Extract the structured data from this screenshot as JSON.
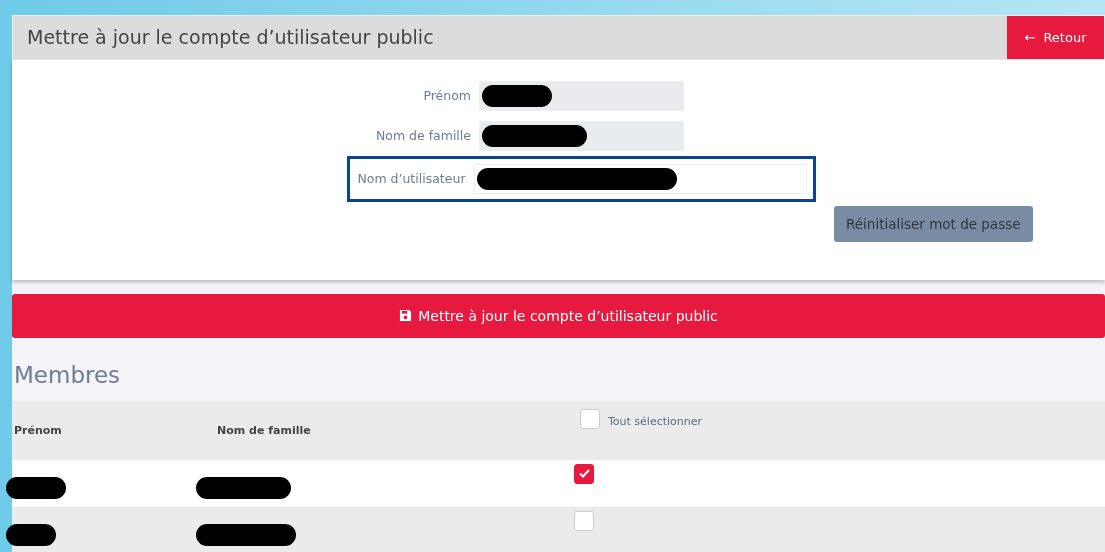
{
  "header": {
    "title": "Mettre à jour le compte d’utilisateur public",
    "back_button": {
      "arrow": "←",
      "label": "Retour"
    }
  },
  "form": {
    "fields": [
      {
        "label": "Prénom",
        "readonly": true,
        "redacted": true,
        "highlighted": false
      },
      {
        "label": "Nom de famille",
        "readonly": true,
        "redacted": true,
        "highlighted": false
      },
      {
        "label": "Nom d’utilisateur",
        "readonly": false,
        "redacted": true,
        "highlighted": true
      }
    ],
    "reset_button": "Réinitialiser mot de passe"
  },
  "save_button": "Mettre à jour le compte d’utilisateur public",
  "members": {
    "title": "Membres",
    "columns": [
      "Prénom",
      "Nom de famille"
    ],
    "select_all": {
      "label": "Tout sélectionner",
      "checked": false
    },
    "rows": [
      {
        "first_name_redacted": true,
        "last_name_redacted": true,
        "checked": true
      },
      {
        "first_name_redacted": true,
        "last_name_redacted": true,
        "checked": false
      }
    ]
  }
}
